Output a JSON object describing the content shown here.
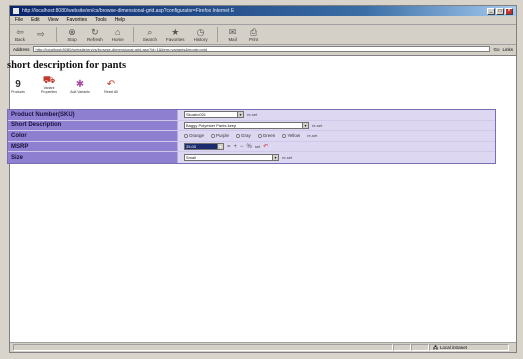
{
  "window": {
    "title": "http://localhost:8080/website/en/cs/browse-dimensional-grid.asp?configurator=Firefox Internet E"
  },
  "menubar": {
    "items": [
      "File",
      "Edit",
      "View",
      "Favorites",
      "Tools",
      "Help"
    ]
  },
  "toolbar": {
    "buttons": [
      {
        "label": "Back",
        "icon": "back-arrow-icon"
      },
      {
        "label": "Stop",
        "icon": "stop-icon"
      },
      {
        "label": "Refresh",
        "icon": "refresh-icon"
      },
      {
        "label": "Home",
        "icon": "home-icon"
      },
      {
        "label": "Search",
        "icon": "search-icon"
      },
      {
        "label": "Favorites",
        "icon": "favorites-icon"
      },
      {
        "label": "History",
        "icon": "history-icon"
      },
      {
        "label": "Mail",
        "icon": "mail-icon"
      },
      {
        "label": "Print",
        "icon": "print-icon"
      }
    ]
  },
  "address": {
    "label": "Address",
    "url": "http://localhost:8080/website/en/cs/browse-dimensional-grid.asp?id=1&item=variants&mode=grid",
    "go": "Go",
    "links": "Links"
  },
  "page": {
    "title": "short description for pants",
    "icons": [
      {
        "label": "Products",
        "icon": "products-icon"
      },
      {
        "label": "Variant Properties",
        "icon": "variant-properties-icon"
      },
      {
        "label": "Add Variants",
        "icon": "add-variants-icon"
      },
      {
        "label": "Reset All",
        "icon": "reset-icon"
      }
    ],
    "fields": [
      {
        "label": "Product Number(SKU)",
        "value": "Skuabc001",
        "action": "re-set"
      },
      {
        "label": "Short Description",
        "value": "Baggy Polyester Pants keep",
        "action": "re-set"
      },
      {
        "label": "Color",
        "options": [
          "Orange",
          "Purple",
          "Gray",
          "Green",
          "Yellow"
        ],
        "action": "re-set"
      },
      {
        "label": "MSRP",
        "value": "35.00",
        "action": "set"
      },
      {
        "label": "Size",
        "value": "Small",
        "action": "re-set"
      }
    ]
  },
  "status": {
    "zone": "Local intranet"
  }
}
